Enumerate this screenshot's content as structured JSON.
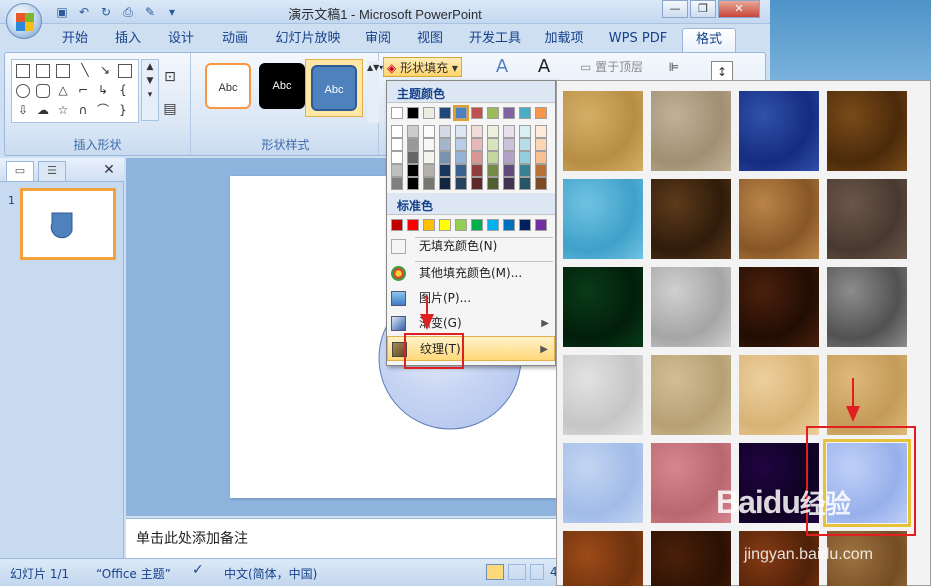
{
  "window": {
    "title": "演示文稿1 - Microsoft PowerPoint",
    "minimize": "—",
    "restore": "❐",
    "close": "✕"
  },
  "qat": [
    "save-icon",
    "undo-icon",
    "redo-icon",
    "print-preview-icon",
    "spell-icon",
    "qat-dropdown-icon"
  ],
  "tabs": [
    "开始",
    "插入",
    "设计",
    "动画",
    "幻灯片放映",
    "审阅",
    "视图",
    "开发工具",
    "加载项",
    "WPS PDF",
    "格式"
  ],
  "active_tab": "格式",
  "ribbon": {
    "insert_shapes_label": "插入形状",
    "shape_styles_label": "形状样式",
    "style_thumbs": [
      "Abc",
      "Abc",
      "Abc"
    ],
    "shape_fill": "形状填充",
    "bring_front": "置于顶层"
  },
  "menu": {
    "theme_colors": "主题颜色",
    "standard_colors": "标准色",
    "no_fill": "无填充颜色(N)",
    "more_colors": "其他填充颜色(M)...",
    "picture": "图片(P)...",
    "gradient": "渐变(G)",
    "texture": "纹理(T)",
    "theme_row": [
      "#ffffff",
      "#000000",
      "#eeece1",
      "#1f497d",
      "#4f81bd",
      "#c0504d",
      "#9bbb59",
      "#8064a2",
      "#4bacc6",
      "#f79646"
    ],
    "standard_row": [
      "#c00000",
      "#ff0000",
      "#ffc000",
      "#ffff00",
      "#92d050",
      "#00b050",
      "#00b0f0",
      "#0070c0",
      "#002060",
      "#7030a0"
    ]
  },
  "panel": {
    "slide_number": "1"
  },
  "notes_placeholder": "单击此处添加备注",
  "status": {
    "slide_info": "幻灯片 1/1",
    "theme": "“Office 主题”",
    "language": "中文(简体，中国)",
    "zoom_fragment": "4"
  },
  "watermark": {
    "brand": "Baidu",
    "site": "经验",
    "url": "jingyan.baidu.com"
  },
  "colors": {
    "accent": "#e02020",
    "ribbon_text": "#15428b",
    "shape_fill": "#4f81bd"
  }
}
